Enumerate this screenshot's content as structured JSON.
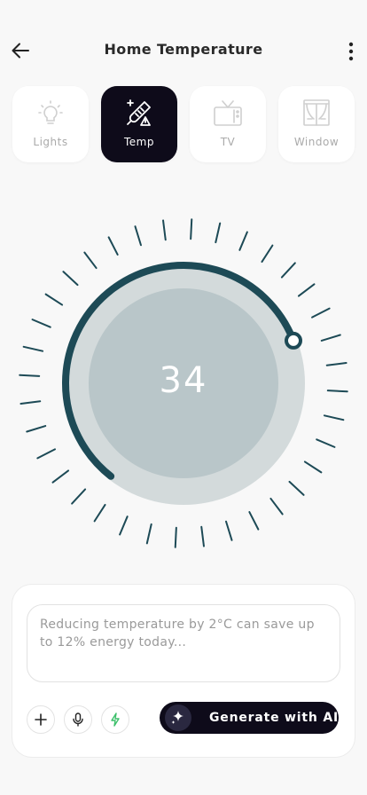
{
  "header": {
    "title": "Home Temperature",
    "back_icon": "arrow-left-icon",
    "menu_icon": "vertical-dots-icon"
  },
  "devices": [
    {
      "label": "Lights",
      "icon": "lightbulb-icon",
      "active": false
    },
    {
      "label": "Temp",
      "icon": "thermometer-icon",
      "active": true
    },
    {
      "label": "TV",
      "icon": "tv-icon",
      "active": false
    },
    {
      "label": "Window",
      "icon": "window-icon",
      "active": false
    }
  ],
  "thermostat": {
    "value": "34",
    "level": 0.68
  },
  "assistant": {
    "prompt_text": "Reducing temperature by 2°C can save up to 12% energy today...",
    "add_icon": "plus-icon",
    "mic_icon": "microphone-icon",
    "bolt_icon": "lightning-icon",
    "generate_label": "Generate with AI",
    "generate_icon": "sparkle-icon"
  },
  "colors": {
    "accent_dark": "#0e0b1a",
    "dial_track": "#1d4a56",
    "bolt_green": "#3cbf6a"
  }
}
